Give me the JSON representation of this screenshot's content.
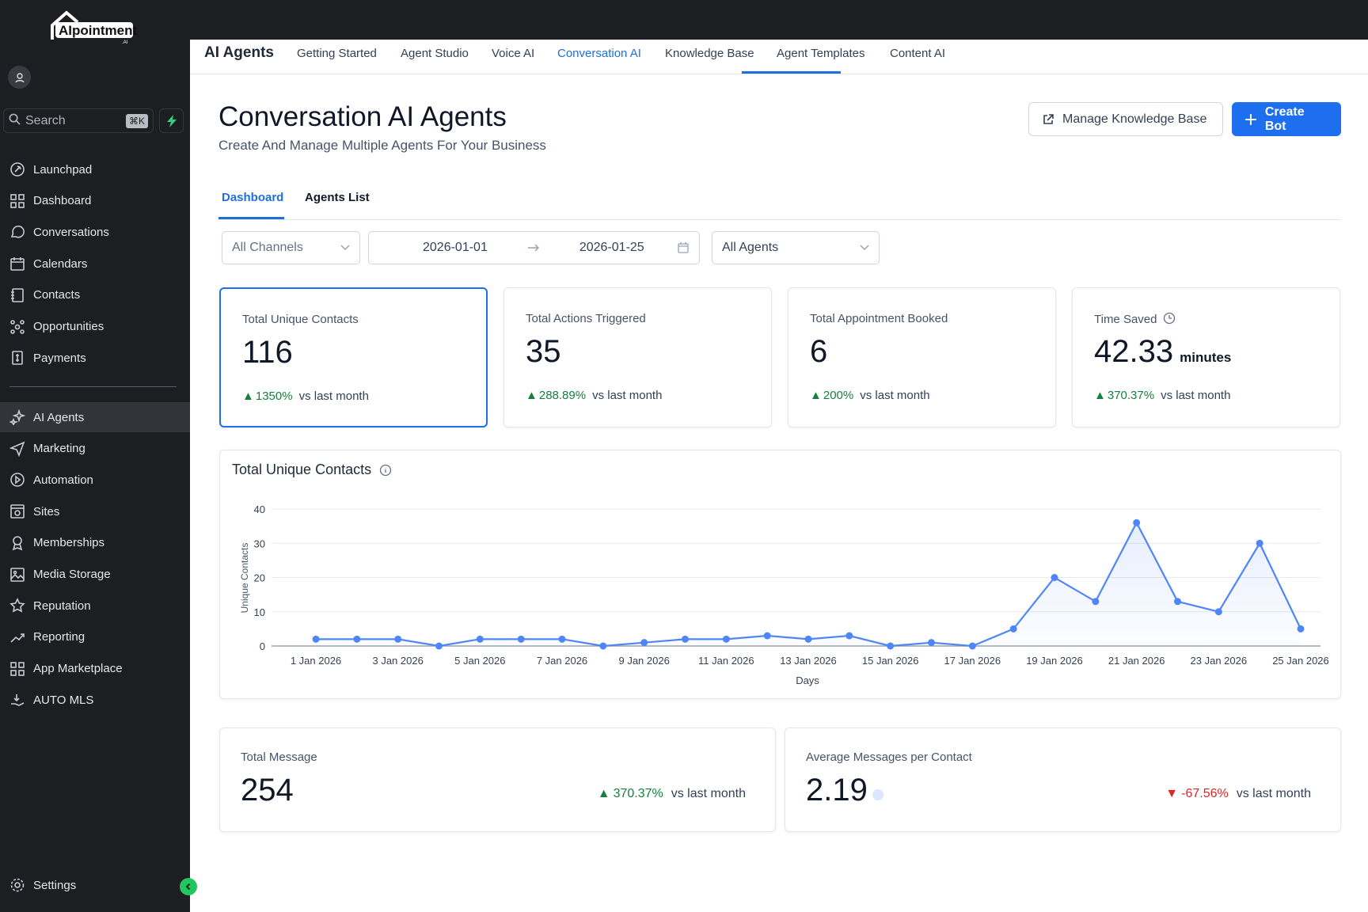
{
  "brand": {
    "logo_text": "AIpointment",
    "logo_sub": ".AI"
  },
  "sidebar": {
    "search_placeholder": "Search",
    "search_shortcut": "⌘K",
    "items": [
      {
        "label": "Launchpad",
        "icon": "rocket-icon"
      },
      {
        "label": "Dashboard",
        "icon": "grid-icon"
      },
      {
        "label": "Conversations",
        "icon": "chat-icon"
      },
      {
        "label": "Calendars",
        "icon": "calendar-icon"
      },
      {
        "label": "Contacts",
        "icon": "contacts-icon"
      },
      {
        "label": "Opportunities",
        "icon": "opportunities-icon"
      },
      {
        "label": "Payments",
        "icon": "payments-icon"
      },
      {
        "label": "AI Agents",
        "icon": "sparkle-icon",
        "active": true
      },
      {
        "label": "Marketing",
        "icon": "send-icon"
      },
      {
        "label": "Automation",
        "icon": "automation-icon"
      },
      {
        "label": "Sites",
        "icon": "sites-icon"
      },
      {
        "label": "Memberships",
        "icon": "award-icon"
      },
      {
        "label": "Media Storage",
        "icon": "image-icon"
      },
      {
        "label": "Reputation",
        "icon": "star-icon"
      },
      {
        "label": "Reporting",
        "icon": "trend-icon"
      },
      {
        "label": "App Marketplace",
        "icon": "apps-icon"
      },
      {
        "label": "AUTO MLS",
        "icon": "hand-icon"
      }
    ],
    "settings_label": "Settings"
  },
  "topnav": {
    "title": "AI Agents",
    "tabs": [
      "Getting Started",
      "Agent Studio",
      "Voice AI",
      "Conversation AI",
      "Knowledge Base",
      "Agent Templates",
      "Content AI"
    ],
    "active": "Conversation AI"
  },
  "page": {
    "title": "Conversation AI Agents",
    "subtitle": "Create And Manage Multiple Agents For Your Business",
    "manage_kb_label": "Manage Knowledge Base",
    "create_bot_label": "Create Bot",
    "subtabs": [
      "Dashboard",
      "Agents List"
    ],
    "filters": {
      "channel": "All Channels",
      "date_start": "2026-01-01",
      "date_end": "2026-01-25",
      "agent": "All Agents"
    }
  },
  "kpis": [
    {
      "label": "Total Unique Contacts",
      "value": "116",
      "unit": "",
      "delta": "1350%",
      "direction": "up",
      "compare": "vs last month"
    },
    {
      "label": "Total Actions Triggered",
      "value": "35",
      "unit": "",
      "delta": "288.89%",
      "direction": "up",
      "compare": "vs last month"
    },
    {
      "label": "Total Appointment Booked",
      "value": "6",
      "unit": "",
      "delta": "200%",
      "direction": "up",
      "compare": "vs last month"
    },
    {
      "label": "Time Saved",
      "value": "42.33",
      "unit": "minutes",
      "delta": "370.37%",
      "direction": "up",
      "compare": "vs last month"
    }
  ],
  "bottom": [
    {
      "label": "Total Message",
      "value": "254",
      "delta": "370.37%",
      "direction": "up",
      "compare": "vs last month"
    },
    {
      "label": "Average Messages per Contact",
      "value": "2.19",
      "delta": "-67.56%",
      "direction": "down",
      "compare": "vs last month"
    }
  ],
  "colors": {
    "accent": "#1e6ff0",
    "up": "#15803d",
    "down": "#dc2626",
    "sidebar": "#1d1e22",
    "line": "#4f86f7"
  },
  "chart_data": {
    "type": "area",
    "title": "Total Unique Contacts",
    "xlabel": "Days",
    "ylabel": "Unique Contacts",
    "ylim": [
      0,
      40
    ],
    "yticks": [
      0,
      10,
      20,
      30,
      40
    ],
    "grid": true,
    "x": [
      "1 Jan 2026",
      "2 Jan 2026",
      "3 Jan 2026",
      "4 Jan 2026",
      "5 Jan 2026",
      "6 Jan 2026",
      "7 Jan 2026",
      "8 Jan 2026",
      "9 Jan 2026",
      "10 Jan 2026",
      "11 Jan 2026",
      "12 Jan 2026",
      "13 Jan 2026",
      "14 Jan 2026",
      "15 Jan 2026",
      "16 Jan 2026",
      "17 Jan 2026",
      "18 Jan 2026",
      "19 Jan 2026",
      "20 Jan 2026",
      "21 Jan 2026",
      "22 Jan 2026",
      "23 Jan 2026",
      "24 Jan 2026",
      "25 Jan 2026"
    ],
    "xtick_labels": [
      "1 Jan 2026",
      "3 Jan 2026",
      "5 Jan 2026",
      "7 Jan 2026",
      "9 Jan 2026",
      "11 Jan 2026",
      "13 Jan 2026",
      "15 Jan 2026",
      "17 Jan 2026",
      "19 Jan 2026",
      "21 Jan 2026",
      "23 Jan 2026",
      "25 Jan 2026"
    ],
    "values": [
      2,
      2,
      2,
      0,
      2,
      2,
      2,
      0,
      1,
      2,
      2,
      3,
      2,
      3,
      0,
      1,
      0,
      5,
      20,
      13,
      36,
      13,
      10,
      30,
      5
    ]
  }
}
